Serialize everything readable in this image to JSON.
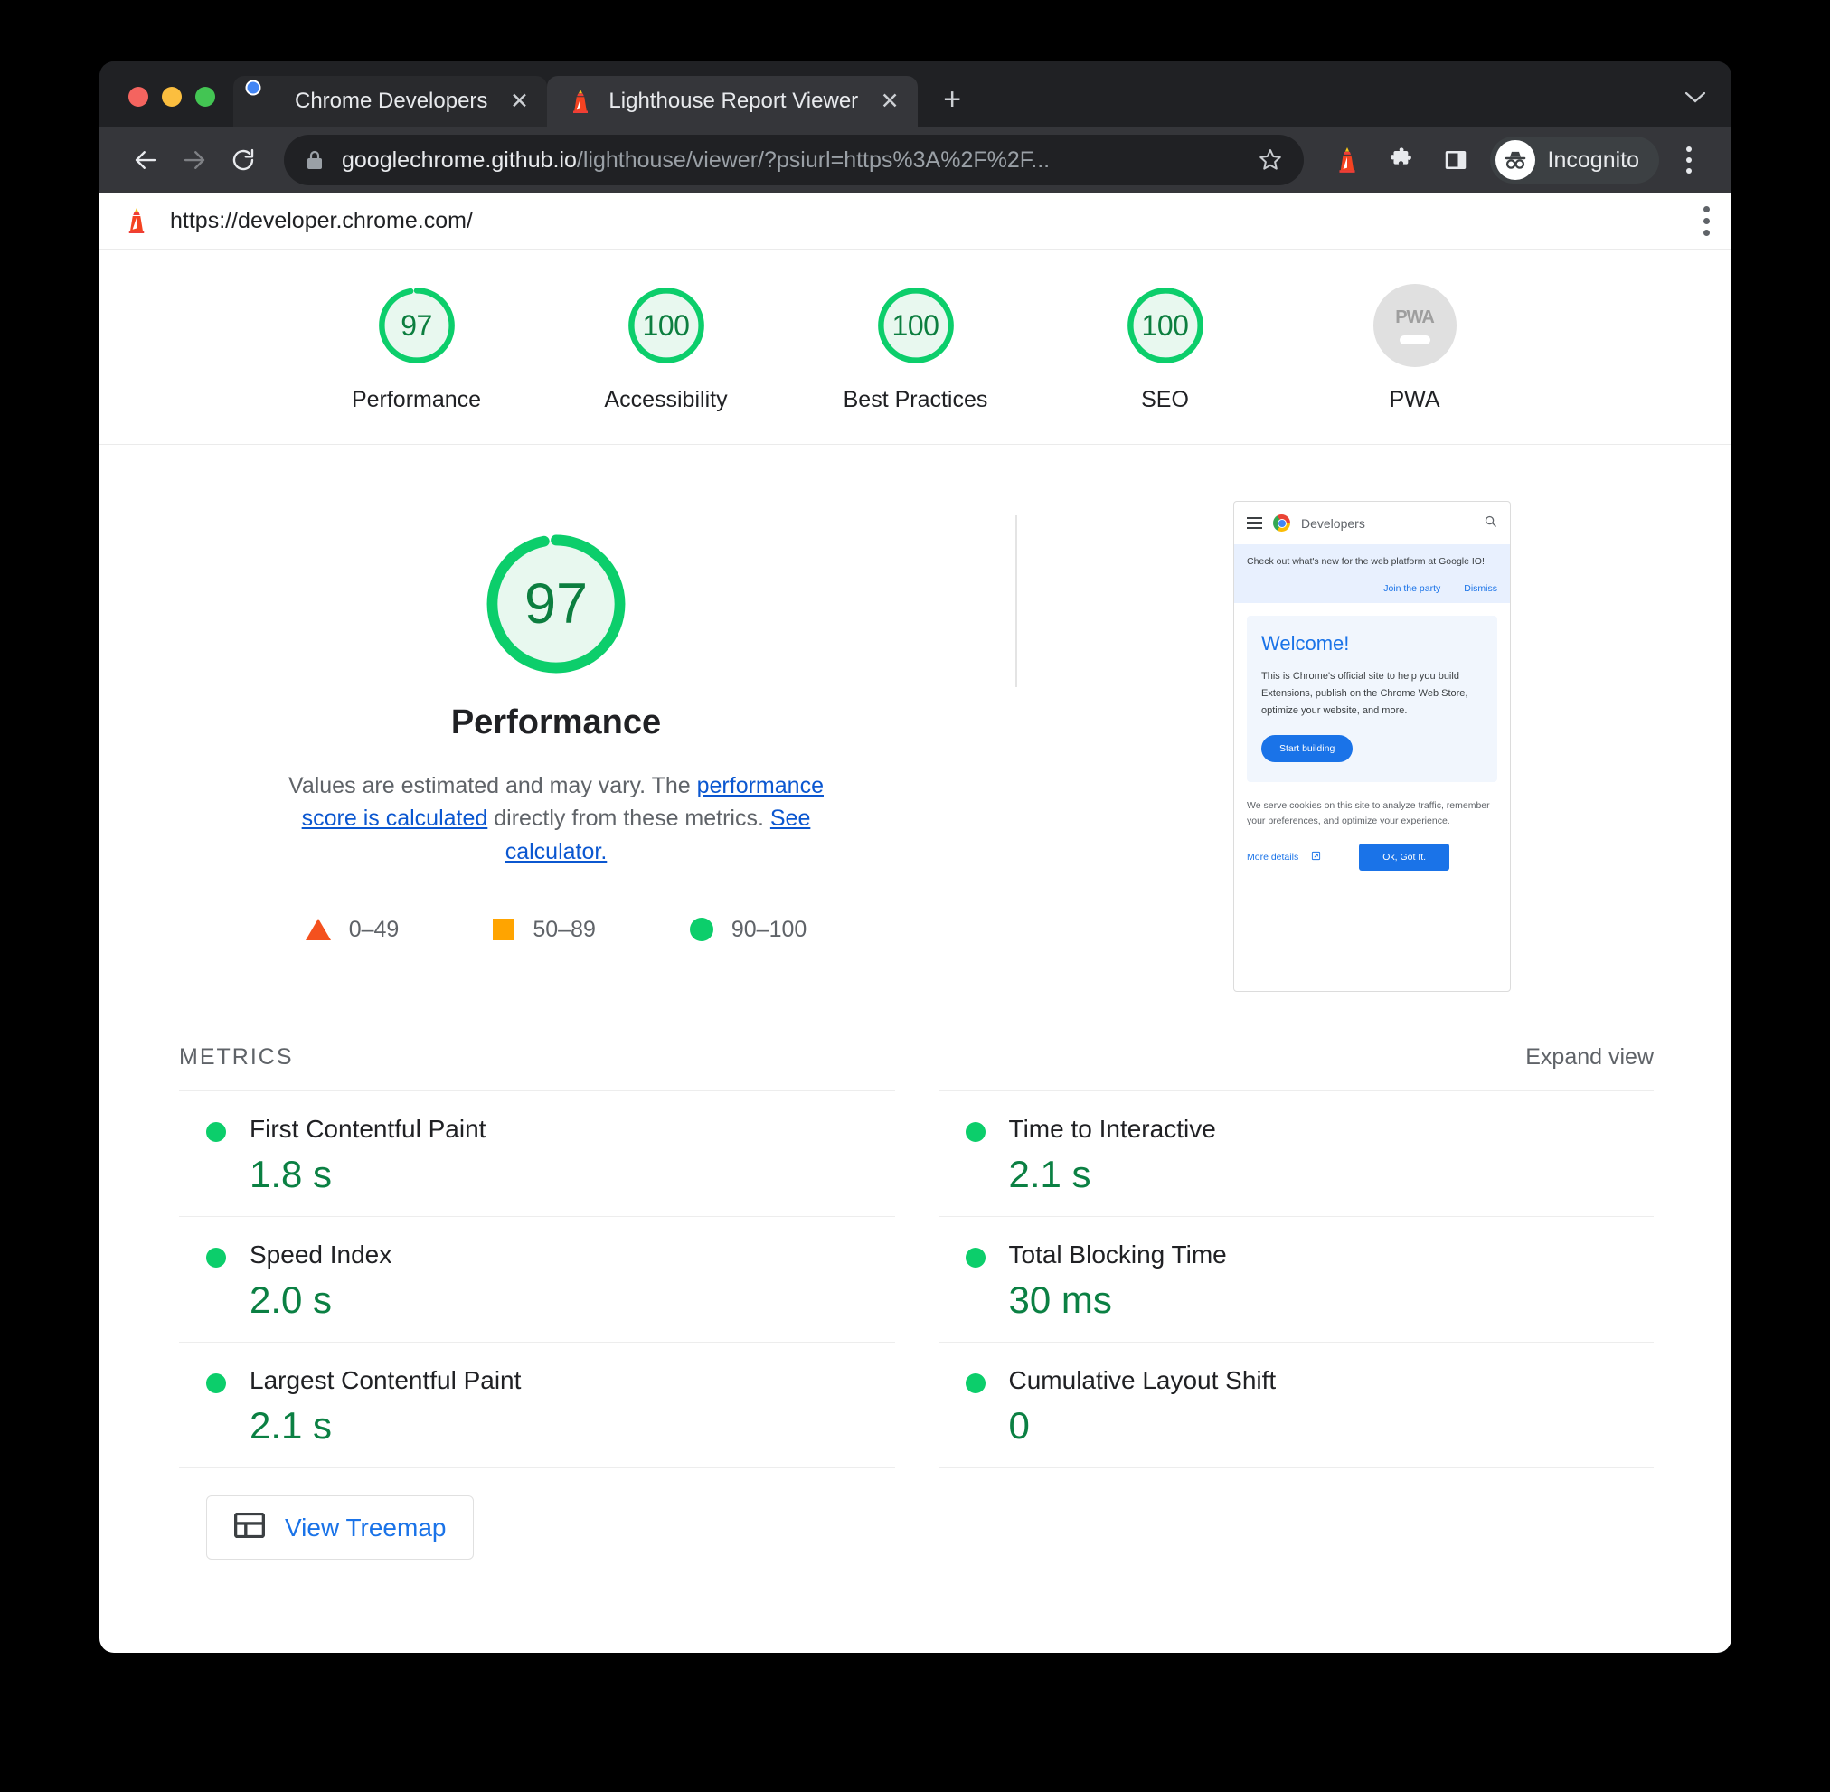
{
  "browser": {
    "tabs": [
      {
        "title": "Chrome Developers",
        "favicon": "chrome-logo-icon",
        "active": false
      },
      {
        "title": "Lighthouse Report Viewer",
        "favicon": "lighthouse-icon",
        "active": true
      }
    ],
    "new_tab_label": "+",
    "tab_close_label": "✕",
    "omnibox": {
      "url_host": "googlechrome.github.io",
      "url_path": "/lighthouse/viewer/?psiurl=https%3A%2F%2F...",
      "lock_icon": "lock-icon",
      "star_icon": "bookmark-star-icon"
    },
    "toolbar_icons": [
      "lighthouse-extension-icon",
      "extensions-puzzle-icon",
      "side-panel-icon"
    ],
    "profile": {
      "label": "Incognito",
      "icon": "incognito-icon"
    },
    "menu_icon": "kebab-menu-icon",
    "back_icon": "back-arrow-icon",
    "forward_icon": "forward-arrow-icon",
    "reload_icon": "reload-icon"
  },
  "report": {
    "header": {
      "url": "https://developer.chrome.com/",
      "icon": "lighthouse-icon",
      "menu_icon": "kebab-menu-icon"
    },
    "gauges": [
      {
        "score": "97",
        "label": "Performance",
        "pct": 97,
        "state": "pass"
      },
      {
        "score": "100",
        "label": "Accessibility",
        "pct": 100,
        "state": "pass"
      },
      {
        "score": "100",
        "label": "Best Practices",
        "pct": 100,
        "state": "pass"
      },
      {
        "score": "100",
        "label": "SEO",
        "pct": 100,
        "state": "pass"
      },
      {
        "score": "PWA",
        "label": "PWA",
        "pct": 0,
        "state": "na"
      }
    ],
    "performance": {
      "score": "97",
      "title": "Performance",
      "desc_1": "Values are estimated and may vary. The ",
      "desc_link_1": "performance score is calculated",
      "desc_2": " directly from these metrics. ",
      "desc_link_2": "See calculator.",
      "legend": [
        {
          "shape": "triangle",
          "range": "0–49",
          "color": "#f4511e"
        },
        {
          "shape": "square",
          "range": "50–89",
          "color": "#ffa400"
        },
        {
          "shape": "circle",
          "range": "90–100",
          "color": "#0cce6b"
        }
      ]
    },
    "thumbnail": {
      "site_name": "Developers",
      "menu_icon": "hamburger-icon",
      "search_icon": "search-icon",
      "banner_text": "Check out what's new for the web platform at Google IO!",
      "banner_action_1": "Join the party",
      "banner_action_2": "Dismiss",
      "hero_title": "Welcome!",
      "hero_text": "This is Chrome's official site to help you build Extensions, publish on the Chrome Web Store, optimize your website, and more.",
      "hero_button": "Start building",
      "cookie_text": "We serve cookies on this site to analyze traffic, remember your preferences, and optimize your experience.",
      "cookie_link": "More details",
      "cookie_link_icon": "external-link-icon",
      "cookie_button": "Ok, Got It."
    },
    "metrics_section": {
      "title": "METRICS",
      "expand_label": "Expand view",
      "items": [
        {
          "name": "First Contentful Paint",
          "value": "1.8 s",
          "state": "pass"
        },
        {
          "name": "Time to Interactive",
          "value": "2.1 s",
          "state": "pass"
        },
        {
          "name": "Speed Index",
          "value": "2.0 s",
          "state": "pass"
        },
        {
          "name": "Total Blocking Time",
          "value": "30 ms",
          "state": "pass"
        },
        {
          "name": "Largest Contentful Paint",
          "value": "2.1 s",
          "state": "pass"
        },
        {
          "name": "Cumulative Layout Shift",
          "value": "0",
          "state": "pass"
        }
      ],
      "treemap_button": {
        "label": "View Treemap",
        "icon": "treemap-icon"
      }
    }
  },
  "colors": {
    "pass_green": "#0cce6b",
    "pass_text": "#0b8043",
    "average_orange": "#ffa400",
    "fail_red": "#f4511e",
    "link_blue": "#1a73e8",
    "na_gray": "#e0e0e0"
  }
}
